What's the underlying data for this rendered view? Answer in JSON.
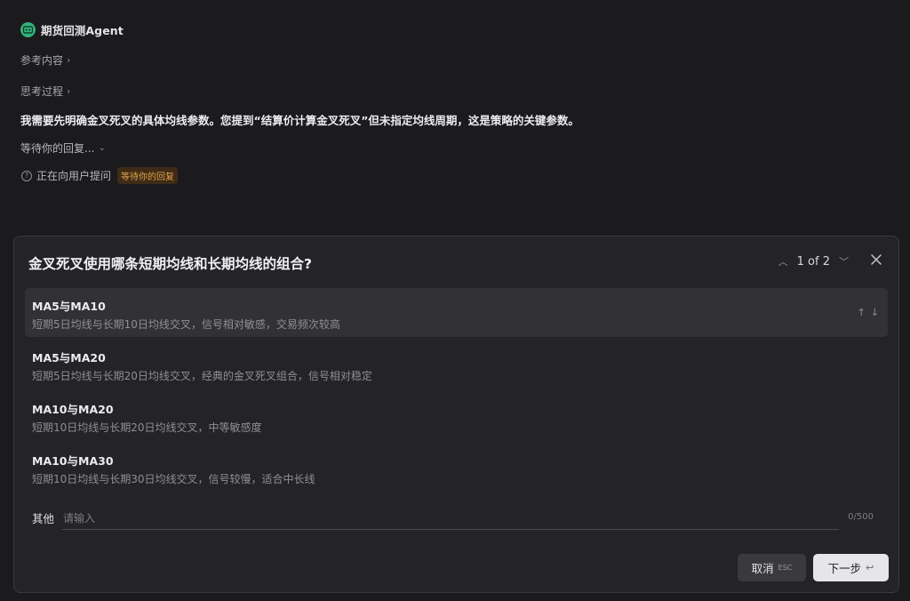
{
  "agent": {
    "name": "期货回测Agent",
    "logo_icon": "robot-icon",
    "logo_color": "#2fb37a"
  },
  "sections": {
    "references_label": "参考内容",
    "thinking_label": "思考过程"
  },
  "message": "我需要先明确金叉死叉的具体均线参数。您提到“结算价计算金叉死叉”但未指定均线周期，这是策略的关键参数。",
  "waiting_label": "等待你的回复...",
  "status": {
    "text": "正在向用户提问",
    "badge": "等待你的回复",
    "badge_color": "#e3a04a"
  },
  "dialog": {
    "title": "金叉死叉使用哪条短期均线和长期均线的组合?",
    "pager": "1 of 2",
    "options": [
      {
        "title": "MA5与MA10",
        "desc": "短期5日均线与长期10日均线交叉，信号相对敏感，交易频次较高",
        "selected": true
      },
      {
        "title": "MA5与MA20",
        "desc": "短期5日均线与长期20日均线交叉，经典的金叉死叉组合，信号相对稳定"
      },
      {
        "title": "MA10与MA20",
        "desc": "短期10日均线与长期20日均线交叉，中等敏感度"
      },
      {
        "title": "MA10与MA30",
        "desc": "短期10日均线与长期30日均线交叉，信号较慢，适合中长线"
      }
    ],
    "other_label": "其他",
    "other_placeholder": "请输入",
    "other_value": "",
    "counter": "0/500",
    "cancel_label": "取消",
    "cancel_key": "ESC",
    "next_label": "下一步",
    "next_key": "↩"
  }
}
